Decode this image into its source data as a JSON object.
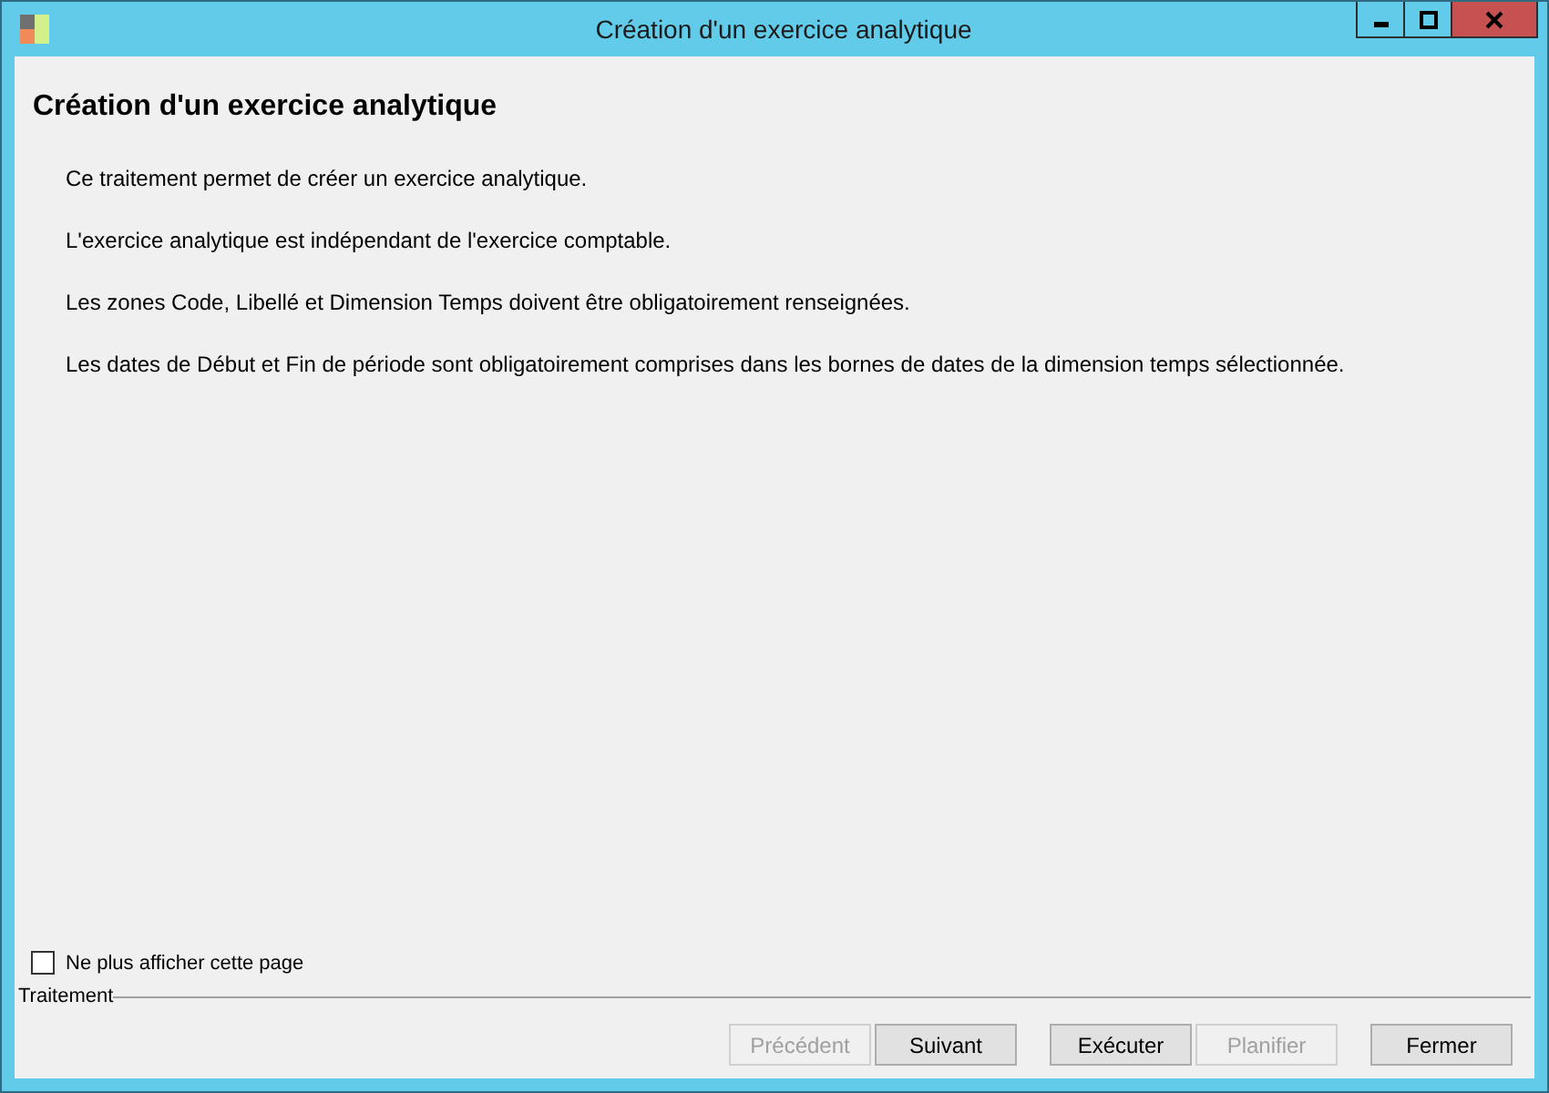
{
  "window": {
    "title": "Création d'un exercice analytique"
  },
  "heading": "Création d'un exercice analytique",
  "paragraphs": [
    "Ce traitement permet de créer un exercice analytique.",
    "L'exercice analytique est indépendant de l'exercice comptable.",
    "Les zones Code, Libellé et Dimension Temps doivent être obligatoirement renseignées.",
    "Les dates de Début et Fin de période sont obligatoirement comprises dans les bornes de dates de la dimension temps sélectionnée."
  ],
  "dont_show_again": {
    "label": "Ne plus afficher cette page",
    "checked": false
  },
  "group_label": "Traitement",
  "button_groups": [
    [
      {
        "label": "Précédent",
        "disabled": true
      },
      {
        "label": "Suivant",
        "disabled": false
      }
    ],
    [
      {
        "label": "Exécuter",
        "disabled": false
      },
      {
        "label": "Planifier",
        "disabled": true
      }
    ],
    [
      {
        "label": "Fermer",
        "disabled": false
      }
    ]
  ]
}
